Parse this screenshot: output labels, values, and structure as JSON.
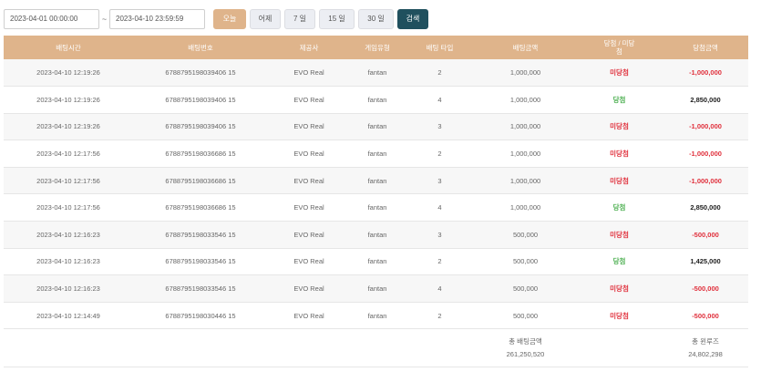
{
  "filter": {
    "start_date": "2023-04-01 00:00:00",
    "separator": "~",
    "end_date": "2023-04-10 23:59:59",
    "buttons": {
      "today": "오늘",
      "yesterday": "어제",
      "days7": "7 일",
      "days15": "15 일",
      "days30": "30 일",
      "search": "검색"
    }
  },
  "table": {
    "headers": [
      "배팅시간",
      "배팅번호",
      "제공사",
      "게임유형",
      "배팅 타입",
      "배팅금액",
      "당첨 / 미당첨",
      "당첨금액"
    ],
    "rows": [
      {
        "time": "2023-04-10 12:19:26",
        "bet_no": "6788795198039406 15",
        "provider": "EVO Real",
        "game": "fantan",
        "type": "2",
        "amount": "1,000,000",
        "result": "미당첨",
        "win_amount": "-1,000,000"
      },
      {
        "time": "2023-04-10 12:19:26",
        "bet_no": "6788795198039406 15",
        "provider": "EVO Real",
        "game": "fantan",
        "type": "4",
        "amount": "1,000,000",
        "result": "당첨",
        "win_amount": "2,850,000"
      },
      {
        "time": "2023-04-10 12:19:26",
        "bet_no": "6788795198039406 15",
        "provider": "EVO Real",
        "game": "fantan",
        "type": "3",
        "amount": "1,000,000",
        "result": "미당첨",
        "win_amount": "-1,000,000"
      },
      {
        "time": "2023-04-10 12:17:56",
        "bet_no": "6788795198036686 15",
        "provider": "EVO Real",
        "game": "fantan",
        "type": "2",
        "amount": "1,000,000",
        "result": "미당첨",
        "win_amount": "-1,000,000"
      },
      {
        "time": "2023-04-10 12:17:56",
        "bet_no": "6788795198036686 15",
        "provider": "EVO Real",
        "game": "fantan",
        "type": "3",
        "amount": "1,000,000",
        "result": "미당첨",
        "win_amount": "-1,000,000"
      },
      {
        "time": "2023-04-10 12:17:56",
        "bet_no": "6788795198036686 15",
        "provider": "EVO Real",
        "game": "fantan",
        "type": "4",
        "amount": "1,000,000",
        "result": "당첨",
        "win_amount": "2,850,000"
      },
      {
        "time": "2023-04-10 12:16:23",
        "bet_no": "6788795198033546 15",
        "provider": "EVO Real",
        "game": "fantan",
        "type": "3",
        "amount": "500,000",
        "result": "미당첨",
        "win_amount": "-500,000"
      },
      {
        "time": "2023-04-10 12:16:23",
        "bet_no": "6788795198033546 15",
        "provider": "EVO Real",
        "game": "fantan",
        "type": "2",
        "amount": "500,000",
        "result": "당첨",
        "win_amount": "1,425,000"
      },
      {
        "time": "2023-04-10 12:16:23",
        "bet_no": "6788795198033546 15",
        "provider": "EVO Real",
        "game": "fantan",
        "type": "4",
        "amount": "500,000",
        "result": "미당첨",
        "win_amount": "-500,000"
      },
      {
        "time": "2023-04-10 12:14:49",
        "bet_no": "6788795198030446 15",
        "provider": "EVO Real",
        "game": "fantan",
        "type": "2",
        "amount": "500,000",
        "result": "미당첨",
        "win_amount": "-500,000"
      }
    ],
    "summary": {
      "total_bet_label": "총 배팅금액",
      "total_bet_value": "261,250,520",
      "total_winloss_label": "총 윈루즈",
      "total_winloss_value": "24,802,298"
    }
  },
  "colors": {
    "accent": "#dfb48b",
    "search": "#20505e",
    "lose": "#e0303c",
    "win": "#4caf50"
  }
}
